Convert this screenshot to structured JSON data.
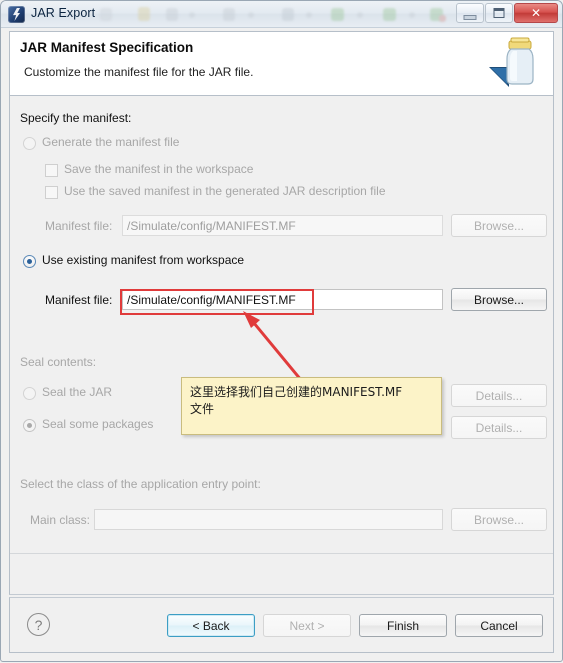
{
  "window": {
    "title": "JAR Export",
    "app_icon": "jar-export-app-icon",
    "buttons": {
      "minimize": "minimize-icon",
      "maximize": "maximize-icon",
      "close": "✕"
    }
  },
  "header": {
    "title": "JAR Manifest Specification",
    "subtitle": "Customize the manifest file for the JAR file.",
    "icon": "jar-jar-icon"
  },
  "main": {
    "specify_label": "Specify the manifest:",
    "generate_radio": {
      "label": "Generate the manifest file",
      "selected": false,
      "enabled": false
    },
    "save_checkbox": {
      "label": "Save the manifest in the workspace",
      "checked": false,
      "enabled": false
    },
    "use_saved_checkbox": {
      "label": "Use the saved manifest in the generated JAR description file",
      "checked": false,
      "enabled": false
    },
    "generate_manifest_file": {
      "label": "Manifest file:",
      "value": "/Simulate/config/MANIFEST.MF",
      "browse_label": "Browse...",
      "enabled": false
    },
    "use_existing_radio": {
      "label": "Use existing manifest from workspace",
      "selected": true,
      "enabled": true
    },
    "existing_manifest_file": {
      "label": "Manifest file:",
      "value": "/Simulate/config/MANIFEST.MF",
      "browse_label": "Browse...",
      "enabled": true
    },
    "seal_contents_label": "Seal contents:",
    "seal_jar_radio": {
      "label": "Seal the JAR",
      "selected": false,
      "enabled": false
    },
    "seal_jar_details": "Details...",
    "seal_packages_radio": {
      "label": "Seal some packages",
      "selected": true,
      "enabled": false
    },
    "seal_packages_details": "Details...",
    "entry_point_label": "Select the class of the application entry point:",
    "main_class": {
      "label": "Main class:",
      "value": "",
      "browse_label": "Browse...",
      "enabled": false
    }
  },
  "footer": {
    "help_icon": "?",
    "back_label": "< Back",
    "next_label": "Next >",
    "finish_label": "Finish",
    "cancel_label": "Cancel",
    "back_enabled": true,
    "next_enabled": false,
    "finish_enabled": true,
    "cancel_enabled": true
  },
  "annotation": {
    "note_line1": "这里选择我们自己创建的MANIFEST.MF",
    "note_line2": "文件",
    "highlight_color": "#e03b3b",
    "note_bg": "#fcf3c8",
    "note_border": "#c9bc7e"
  }
}
